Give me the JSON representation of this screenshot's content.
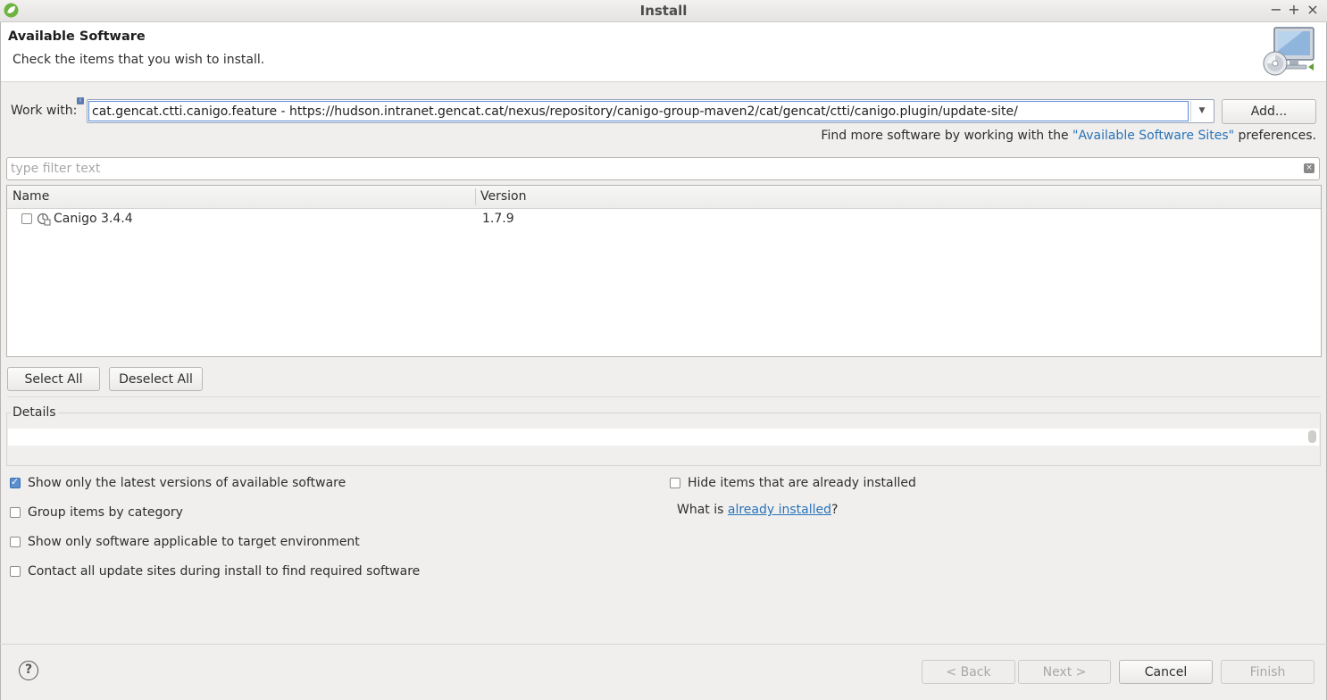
{
  "window": {
    "title": "Install",
    "minimize_glyph": "−",
    "maximize_glyph": "+",
    "close_glyph": "×"
  },
  "header": {
    "title": "Available Software",
    "description": "Check the items that you wish to install."
  },
  "work_with": {
    "label": "Work with:",
    "value": "cat.gencat.ctti.canigo.feature - https://hudson.intranet.gencat.cat/nexus/repository/canigo-group-maven2/cat/gencat/ctti/canigo.plugin/update-site/",
    "add_button": "Add...",
    "find_more_prefix": "Find more software by working with the ",
    "find_more_link": "\"Available Software Sites\"",
    "find_more_suffix": " preferences."
  },
  "filter": {
    "placeholder": "type filter text"
  },
  "table": {
    "columns": [
      "Name",
      "Version"
    ],
    "rows": [
      {
        "name": "Canigo 3.4.4",
        "version": "1.7.9",
        "checked": false
      }
    ]
  },
  "selection_buttons": {
    "select_all": "Select All",
    "deselect_all": "Deselect All"
  },
  "details": {
    "label": "Details"
  },
  "options": {
    "show_latest": {
      "label": "Show only the latest versions of available software",
      "checked": true
    },
    "group_by_category": {
      "label": "Group items by category",
      "checked": false
    },
    "show_applicable": {
      "label": "Show only software applicable to target environment",
      "checked": false
    },
    "contact_all_sites": {
      "label": "Contact all update sites during install to find required software",
      "checked": false
    },
    "hide_installed": {
      "label": "Hide items that are already installed",
      "checked": false
    },
    "what_is_prefix": "What is ",
    "what_is_link": "already installed",
    "what_is_suffix": "?"
  },
  "footer": {
    "help_glyph": "?",
    "back": "< Back",
    "next": "Next >",
    "cancel": "Cancel",
    "finish": "Finish"
  },
  "colors": {
    "link": "#2a73b8",
    "checked": "#5c8fd0",
    "background": "#f0efee"
  }
}
